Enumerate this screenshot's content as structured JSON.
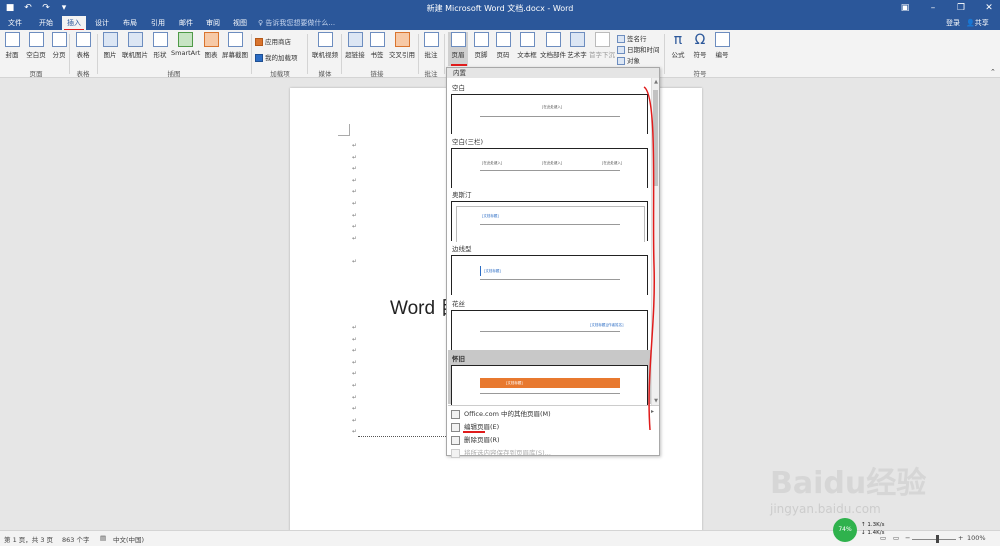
{
  "window": {
    "title": "新建 Microsoft Word 文档.docx - Word"
  },
  "tabs": [
    {
      "label": "文件"
    },
    {
      "label": "开始"
    },
    {
      "label": "插入"
    },
    {
      "label": "设计"
    },
    {
      "label": "布局"
    },
    {
      "label": "引用"
    },
    {
      "label": "邮件"
    },
    {
      "label": "审阅"
    },
    {
      "label": "视图"
    }
  ],
  "search": {
    "placeholder": "告诉我您想要做什么..."
  },
  "account": {
    "login": "登录",
    "share": "共享"
  },
  "ribbon": {
    "pages": {
      "cover": "封面",
      "blank": "空白页",
      "break": "分页",
      "group": "页面"
    },
    "tables": {
      "table": "表格",
      "group": "表格"
    },
    "illustrations": {
      "pictures": "图片",
      "online_pictures": "联机图片",
      "shapes": "形状",
      "smartart": "SmartArt",
      "chart": "图表",
      "screenshot": "屏幕截图",
      "group": "插图"
    },
    "addins": {
      "store": "应用商店",
      "my_addins": "我的加载项",
      "group": "加载项"
    },
    "media": {
      "online_video": "联机视频",
      "group": "媒体"
    },
    "links": {
      "hyperlink": "超链接",
      "bookmark": "书签",
      "cross_ref": "交叉引用",
      "group": "链接"
    },
    "comments": {
      "comment": "批注",
      "group": "批注"
    },
    "header_footer": {
      "header": "页眉",
      "footer": "页脚",
      "page_number": "页码"
    },
    "text": {
      "textbox": "文本框",
      "quickparts": "文档部件",
      "wordart": "艺术字",
      "dropcap": "首字下沉",
      "signature": "签名行",
      "datetime": "日期和时间",
      "object": "对象"
    },
    "symbols": {
      "equation": "公式",
      "symbol": "符号",
      "number": "编号",
      "group": "符号"
    }
  },
  "gallery": {
    "section": "内置",
    "items": [
      {
        "label": "空白",
        "placeholders": [
          "[在此处键入]"
        ]
      },
      {
        "label": "空白(三栏)",
        "placeholders": [
          "[在此处键入]",
          "[在此处键入]",
          "[在此处键入]"
        ]
      },
      {
        "label": "奥斯汀",
        "placeholders": [
          "[文档标题]"
        ]
      },
      {
        "label": "边线型",
        "placeholders": [
          "[文档标题]"
        ]
      },
      {
        "label": "花丝",
        "placeholders": [
          "[文档标题][作者姓名]"
        ]
      },
      {
        "label": "怀旧",
        "placeholders": [
          "[文档标题]"
        ]
      }
    ],
    "menu": [
      {
        "label": "Office.com 中的其他页眉(M)"
      },
      {
        "label": "编辑页眉(E)"
      },
      {
        "label": "删除页眉(R)"
      },
      {
        "label": "将所选内容保存到页眉库(S)..."
      }
    ]
  },
  "document": {
    "big_text": "Word 目"
  },
  "status": {
    "page": "第 1 页，共 3 页",
    "words": "863 个字",
    "language": "中文(中国)",
    "zoom": "100%"
  },
  "network": {
    "percent": "74%",
    "up": "1.3K/s",
    "down": "1.4K/s"
  },
  "watermark": {
    "brand": "Baidu经验",
    "url": "jingyan.baidu.com"
  },
  "colors": {
    "ribbon_blue": "#2b579a",
    "accent_orange": "#e8792f",
    "annotation_red": "#e01b1b"
  }
}
